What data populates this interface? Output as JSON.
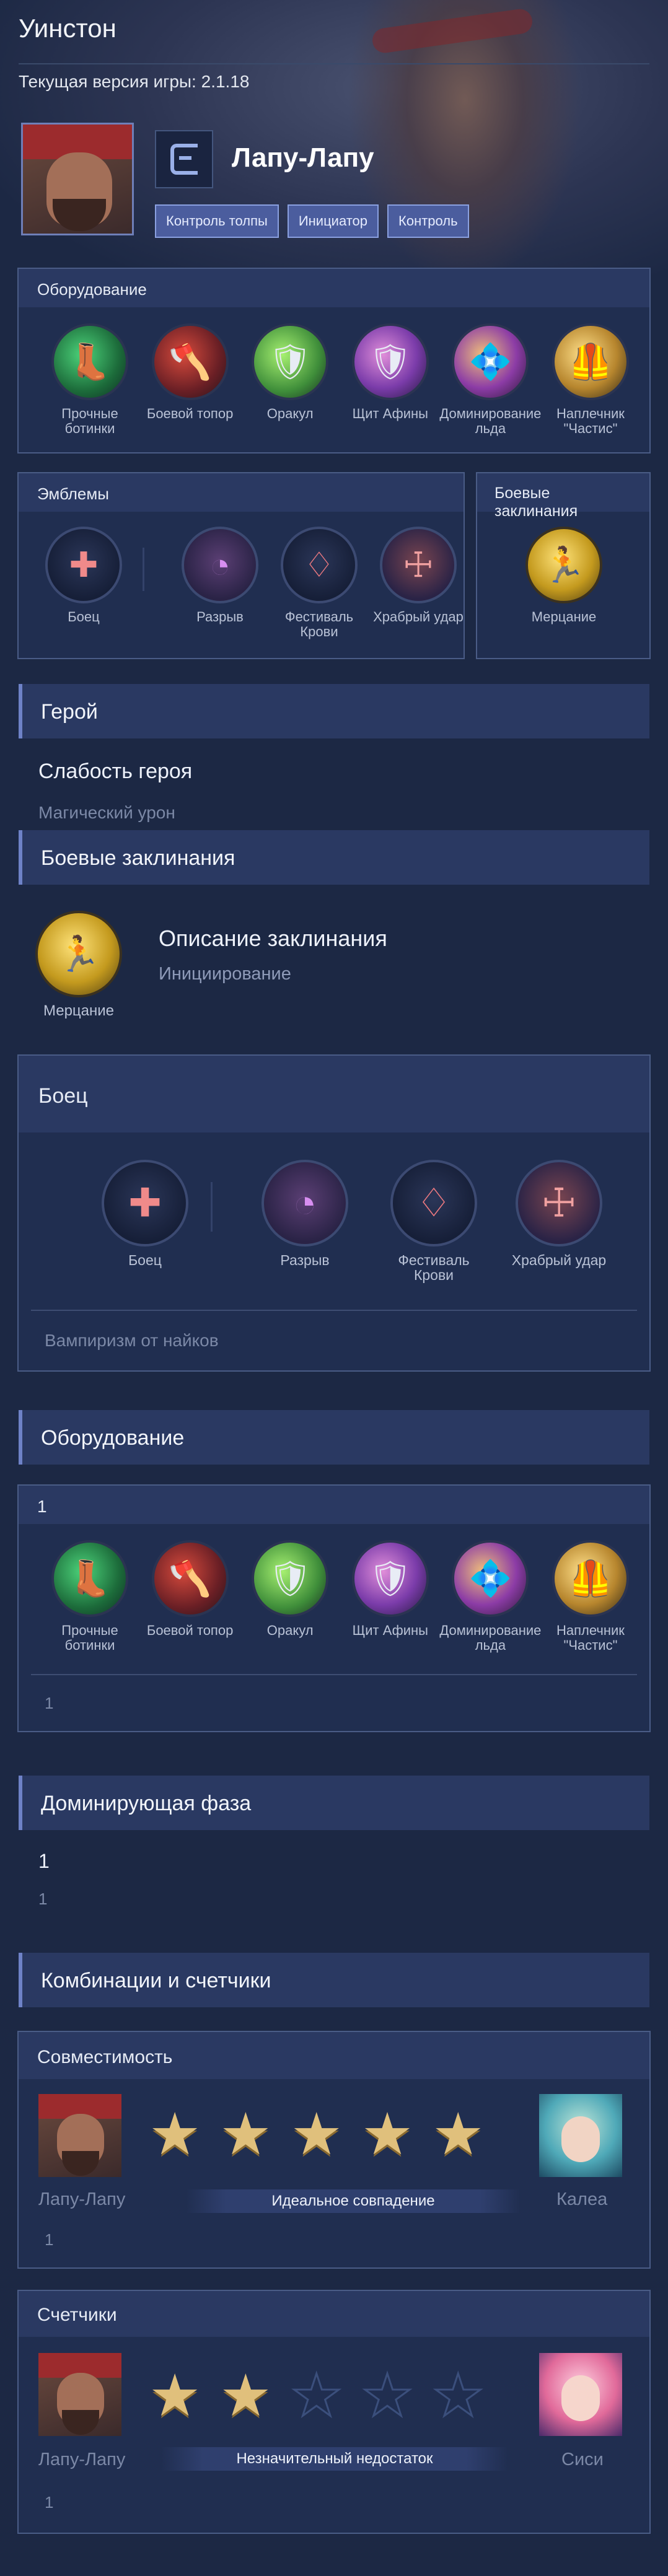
{
  "hero": {
    "title": "Уинстон",
    "version_text": "Текущая версия игры: 2.1.18",
    "name": "Лапу-Лапу",
    "tags": [
      "Контроль толпы",
      "Инициатор",
      "Контроль"
    ]
  },
  "equipment_panel": {
    "title": "Оборудование",
    "items": [
      {
        "label": "Прочные ботинки",
        "icon": "boots-icon"
      },
      {
        "label": "Боевой топор",
        "icon": "war-axe-icon"
      },
      {
        "label": "Оракул",
        "icon": "oracle-icon"
      },
      {
        "label": "Щит Афины",
        "icon": "athena-shield-icon"
      },
      {
        "label": "Доминирование льда",
        "icon": "dominance-ice-icon"
      },
      {
        "label": "Наплечник \"Частис\"",
        "icon": "shoulder-guard-icon"
      }
    ]
  },
  "emblems_panel": {
    "title": "Эмблемы",
    "main": {
      "label": "Боец",
      "icon": "fighter-emblem-icon"
    },
    "talents": [
      {
        "label": "Разрыв",
        "icon": "rupture-icon"
      },
      {
        "label": "Фестиваль Крови",
        "icon": "festival-of-blood-icon"
      },
      {
        "label": "Храбрый удар",
        "icon": "brave-smite-icon"
      }
    ]
  },
  "spells_panel": {
    "title": "Боевые заклинания",
    "spell": {
      "label": "Мерцание",
      "icon": "flicker-icon"
    }
  },
  "section_hero": {
    "title": "Герой",
    "weakness_title": "Слабость героя",
    "weakness_value": "Магический урон"
  },
  "section_spells": {
    "title": "Боевые заклинания",
    "spell_label": "Мерцание",
    "desc_title": "Описание заклинания",
    "desc_value": "Инициирование"
  },
  "fighter_card": {
    "title": "Боец",
    "main_label": "Боец",
    "talents": [
      "Разрыв",
      "Фестиваль Крови",
      "Храбрый удар"
    ],
    "footer": "Вампиризм от найков"
  },
  "section_equipment": {
    "title": "Оборудование",
    "card_title": "1",
    "items": [
      "Прочные ботинки",
      "Боевой топор",
      "Оракул",
      "Щит Афины",
      "Доминирование льда",
      "Наплечник \"Частис\""
    ],
    "footer": "1"
  },
  "section_phase": {
    "title": "Доминирующая фаза",
    "value": "1",
    "sub": "1"
  },
  "section_combos": {
    "title": "Комбинации и счетчики",
    "compat": {
      "title": "Совместимость",
      "left_name": "Лапу-Лапу",
      "right_name": "Калеа",
      "stars_filled": 5,
      "stars_total": 5,
      "verdict": "Идеальное совпадение",
      "note": "1"
    },
    "counters": {
      "title": "Счетчики",
      "left_name": "Лапу-Лапу",
      "right_name": "Сиси",
      "stars_filled": 2,
      "stars_total": 5,
      "verdict": "Незначительный недостаток",
      "note": "1"
    }
  },
  "colors": {
    "background": "#1c2844",
    "panel": "#202e50",
    "panel_header": "#2a3962",
    "accent": "#6e82c7",
    "star": "#e0c07c",
    "tag": "#4b5d9e"
  }
}
